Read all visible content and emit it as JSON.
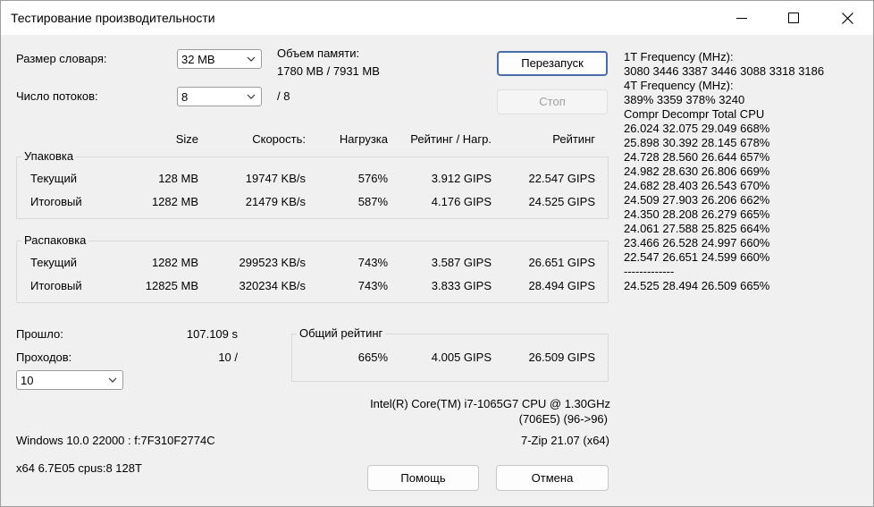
{
  "window": {
    "title": "Тестирование производительности"
  },
  "settings": {
    "dict_size_label": "Размер словаря:",
    "dict_size_value": "32 MB",
    "threads_label": "Число потоков:",
    "threads_value": "8",
    "threads_total": "/ 8",
    "memory_label": "Объем памяти:",
    "memory_value": "1780 MB / 7931 MB"
  },
  "buttons": {
    "restart": "Перезапуск",
    "stop": "Стоп",
    "help": "Помощь",
    "cancel": "Отмена"
  },
  "columns": {
    "size": "Size",
    "speed": "Скорость:",
    "load": "Нагрузка",
    "rating_load": "Рейтинг / Нагр.",
    "rating": "Рейтинг"
  },
  "compress": {
    "title": "Упаковка",
    "rows": [
      {
        "label": "Текущий",
        "size": "128 MB",
        "speed": "19747 KB/s",
        "load": "576%",
        "rating_load": "3.912 GIPS",
        "rating": "22.547 GIPS"
      },
      {
        "label": "Итоговый",
        "size": "1282 MB",
        "speed": "21479 KB/s",
        "load": "587%",
        "rating_load": "4.176 GIPS",
        "rating": "24.525 GIPS"
      }
    ]
  },
  "decompress": {
    "title": "Распаковка",
    "rows": [
      {
        "label": "Текущий",
        "size": "1282 MB",
        "speed": "299523 KB/s",
        "load": "743%",
        "rating_load": "3.587 GIPS",
        "rating": "26.651 GIPS"
      },
      {
        "label": "Итоговый",
        "size": "12825 MB",
        "speed": "320234 KB/s",
        "load": "743%",
        "rating_load": "3.833 GIPS",
        "rating": "28.494 GIPS"
      }
    ]
  },
  "progress": {
    "elapsed_label": "Прошло:",
    "elapsed_value": "107.109 s",
    "passes_label": "Проходов:",
    "passes_value": "10 /",
    "passes_select": "10"
  },
  "total": {
    "title": "Общий рейтинг",
    "load": "665%",
    "rating_load": "4.005 GIPS",
    "rating": "26.509 GIPS"
  },
  "system": {
    "cpu_line1": "Intel(R) Core(TM) i7-1065G7 CPU @ 1.30GHz",
    "cpu_line2": "(706E5) (96->96)",
    "os": "Windows 10.0 22000 :  f:7F310F2774C",
    "arch": "x64 6.7E05 cpus:8 128T",
    "version": "7-Zip 21.07 (x64)"
  },
  "log": {
    "lines": [
      "1T Frequency (MHz):",
      " 3080 3446 3387 3446 3088 3318 3186",
      "4T Frequency (MHz):",
      " 389% 3359 378% 3240",
      "Compr Decompr Total  CPU",
      "26.024  32.075  29.049   668%",
      "25.898  30.392  28.145   678%",
      "24.728  28.560  26.644   657%",
      "24.982  28.630  26.806   669%",
      "24.682  28.403  26.543   670%",
      "24.509  27.903  26.206   662%",
      "24.350  28.208  26.279   665%",
      "24.061  27.588  25.825   664%",
      "23.466  26.528  24.997   660%",
      "22.547  26.651  24.599   660%",
      "-------------",
      "24.525  28.494  26.509   665%"
    ]
  }
}
